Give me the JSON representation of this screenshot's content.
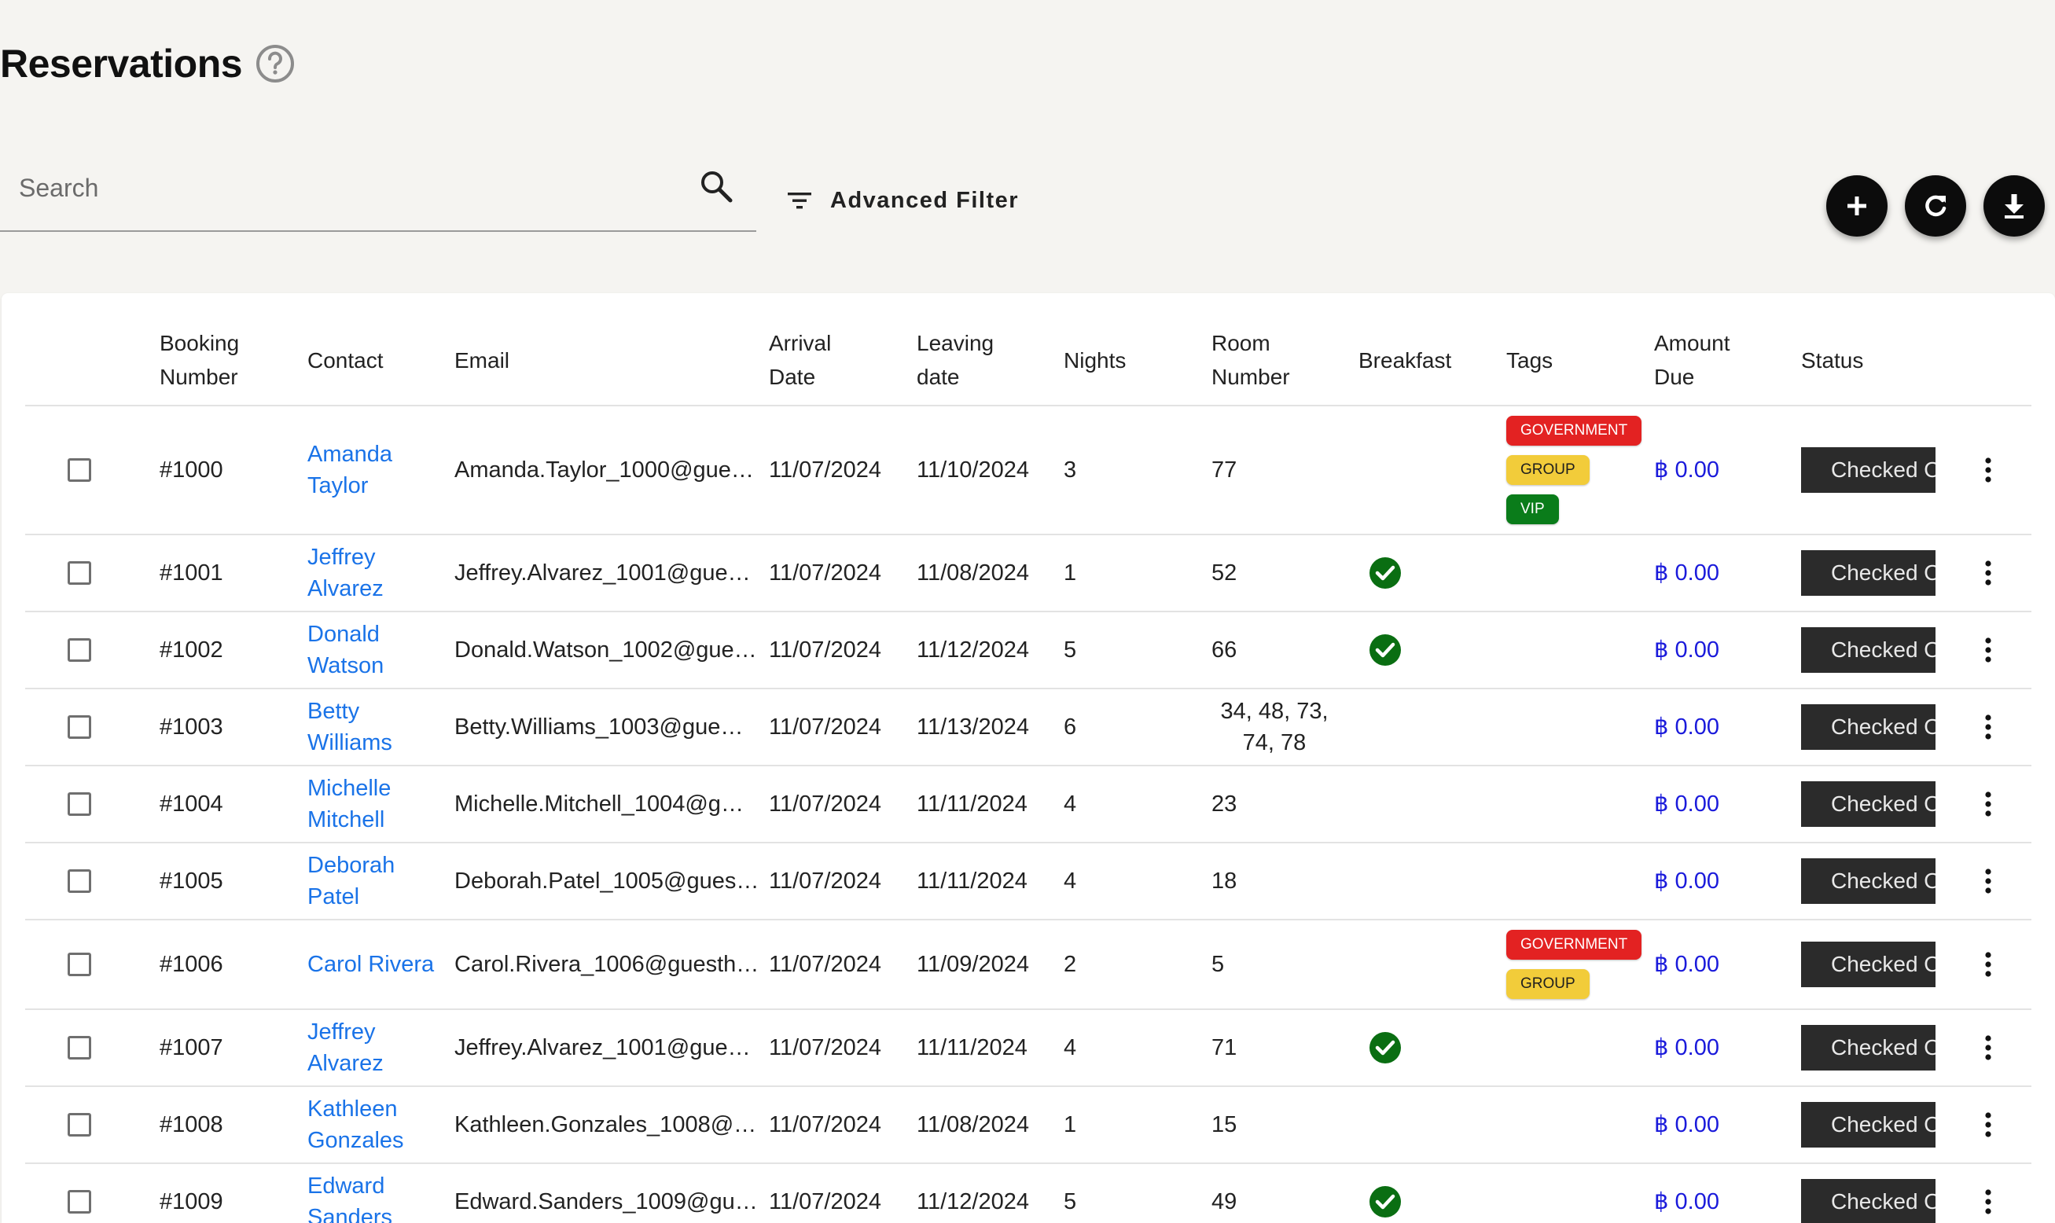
{
  "page": {
    "title": "Reservations"
  },
  "search": {
    "placeholder": "Search"
  },
  "toolbar": {
    "advanced_filter_label": "Advanced Filter"
  },
  "columns": {
    "booking_number": [
      "Booking",
      "Number"
    ],
    "contact": [
      "Contact"
    ],
    "email": [
      "Email"
    ],
    "arrival": [
      "Arrival",
      "Date"
    ],
    "leaving": [
      "Leaving",
      "date"
    ],
    "nights": [
      "Nights"
    ],
    "room": [
      "Room",
      "Number"
    ],
    "breakfast": [
      "Breakfast"
    ],
    "tags": [
      "Tags"
    ],
    "amount": [
      "Amount",
      "Due"
    ],
    "status": [
      "Status"
    ]
  },
  "rows": [
    {
      "booking": "#1000",
      "contact": [
        "Amanda",
        "Taylor"
      ],
      "email": "Amanda.Taylor_1000@gue…",
      "arrival": "11/07/2024",
      "leaving": "11/10/2024",
      "nights": "3",
      "room": [
        "77"
      ],
      "breakfast": false,
      "tags": [
        "GOVERNMENT",
        "GROUP",
        "VIP"
      ],
      "amount": "฿ 0.00",
      "status": "Checked Out"
    },
    {
      "booking": "#1001",
      "contact": [
        "Jeffrey",
        "Alvarez"
      ],
      "email": "Jeffrey.Alvarez_1001@gue…",
      "arrival": "11/07/2024",
      "leaving": "11/08/2024",
      "nights": "1",
      "room": [
        "52"
      ],
      "breakfast": true,
      "tags": [],
      "amount": "฿ 0.00",
      "status": "Checked Out"
    },
    {
      "booking": "#1002",
      "contact": [
        "Donald",
        "Watson"
      ],
      "email": "Donald.Watson_1002@gue…",
      "arrival": "11/07/2024",
      "leaving": "11/12/2024",
      "nights": "5",
      "room": [
        "66"
      ],
      "breakfast": true,
      "tags": [],
      "amount": "฿ 0.00",
      "status": "Checked Out"
    },
    {
      "booking": "#1003",
      "contact": [
        "Betty",
        "Williams"
      ],
      "email": "Betty.Williams_1003@gue…",
      "arrival": "11/07/2024",
      "leaving": "11/13/2024",
      "nights": "6",
      "room": [
        "34, 48, 73,",
        "74, 78"
      ],
      "breakfast": false,
      "tags": [],
      "amount": "฿ 0.00",
      "status": "Checked Out"
    },
    {
      "booking": "#1004",
      "contact": [
        "Michelle",
        "Mitchell"
      ],
      "email": "Michelle.Mitchell_1004@g…",
      "arrival": "11/07/2024",
      "leaving": "11/11/2024",
      "nights": "4",
      "room": [
        "23"
      ],
      "breakfast": false,
      "tags": [],
      "amount": "฿ 0.00",
      "status": "Checked Out"
    },
    {
      "booking": "#1005",
      "contact": [
        "Deborah",
        "Patel"
      ],
      "email": "Deborah.Patel_1005@gues…",
      "arrival": "11/07/2024",
      "leaving": "11/11/2024",
      "nights": "4",
      "room": [
        "18"
      ],
      "breakfast": false,
      "tags": [],
      "amount": "฿ 0.00",
      "status": "Checked Out"
    },
    {
      "booking": "#1006",
      "contact": [
        "Carol Rivera"
      ],
      "email": "Carol.Rivera_1006@guesth…",
      "arrival": "11/07/2024",
      "leaving": "11/09/2024",
      "nights": "2",
      "room": [
        "5"
      ],
      "breakfast": false,
      "tags": [
        "GOVERNMENT",
        "GROUP"
      ],
      "amount": "฿ 0.00",
      "status": "Checked Out"
    },
    {
      "booking": "#1007",
      "contact": [
        "Jeffrey",
        "Alvarez"
      ],
      "email": "Jeffrey.Alvarez_1001@gue…",
      "arrival": "11/07/2024",
      "leaving": "11/11/2024",
      "nights": "4",
      "room": [
        "71"
      ],
      "breakfast": true,
      "tags": [],
      "amount": "฿ 0.00",
      "status": "Checked Out"
    },
    {
      "booking": "#1008",
      "contact": [
        "Kathleen",
        "Gonzales"
      ],
      "email": "Kathleen.Gonzales_1008@…",
      "arrival": "11/07/2024",
      "leaving": "11/08/2024",
      "nights": "1",
      "room": [
        "15"
      ],
      "breakfast": false,
      "tags": [],
      "amount": "฿ 0.00",
      "status": "Checked Out"
    },
    {
      "booking": "#1009",
      "contact": [
        "Edward",
        "Sanders"
      ],
      "email": "Edward.Sanders_1009@gu…",
      "arrival": "11/07/2024",
      "leaving": "11/12/2024",
      "nights": "5",
      "room": [
        "49"
      ],
      "breakfast": true,
      "tags": [],
      "amount": "฿ 0.00",
      "status": "Checked Out"
    }
  ],
  "colors": {
    "link": "#1a73e8",
    "amount": "#1a1adb",
    "tag_government": "#e32222",
    "tag_group": "#f2cc3a",
    "tag_vip": "#0a7c1a",
    "breakfast_check": "#0a6e12",
    "status_button": "#2b2b2b"
  },
  "icons": {
    "help": "help-circle-icon",
    "search": "search-icon",
    "filter": "filter-icon",
    "add": "plus-icon",
    "refresh": "refresh-icon",
    "download": "download-icon",
    "breakfast": "check-circle-icon",
    "row_menu": "more-vertical-icon"
  }
}
